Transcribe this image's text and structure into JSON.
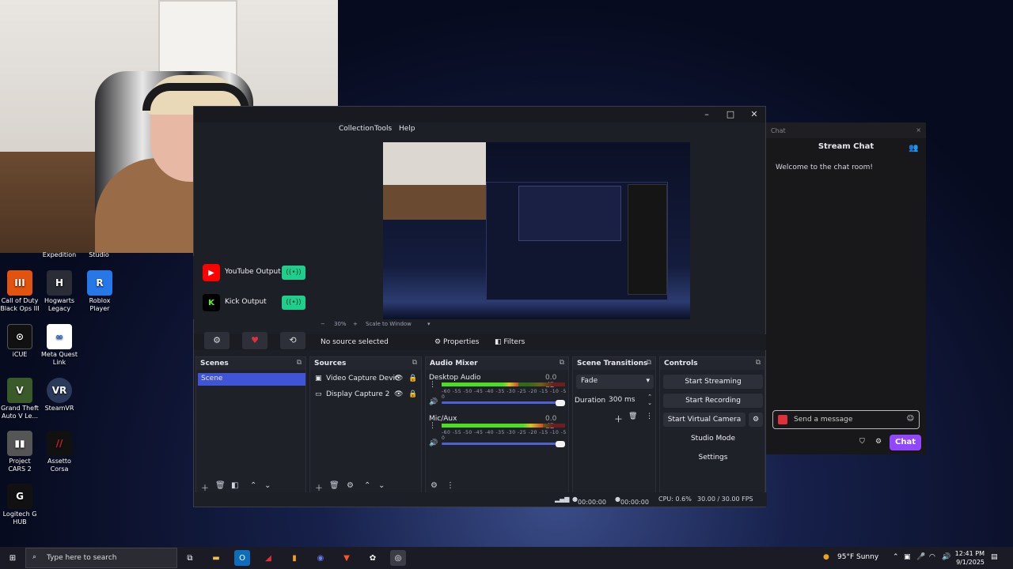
{
  "desktop": {
    "icons": [
      {
        "label": "Expedition",
        "glyph": ""
      },
      {
        "label": "Studio",
        "glyph": ""
      },
      {
        "label": "Call of Duty Black Ops III",
        "glyph": "III"
      },
      {
        "label": "Hogwarts Legacy",
        "glyph": "H"
      },
      {
        "label": "Roblox Player",
        "glyph": "R"
      },
      {
        "label": "iCUE",
        "glyph": "⊙"
      },
      {
        "label": "Meta Quest Link",
        "glyph": "∞"
      },
      {
        "label": "Grand Theft Auto V Le...",
        "glyph": "V"
      },
      {
        "label": "SteamVR",
        "glyph": "VR"
      },
      {
        "label": "Project CARS 2",
        "glyph": "▮▮"
      },
      {
        "label": "Assetto Corsa",
        "glyph": "//"
      },
      {
        "label": "Logitech G HUB",
        "glyph": "G"
      }
    ]
  },
  "obs": {
    "menu": [
      "Collection",
      "Tools",
      "Help"
    ],
    "preview_bar": {
      "zoom": "30%",
      "fit": "Scale to Window"
    },
    "source_bar": {
      "status": "No source selected",
      "properties": "Properties",
      "filters": "Filters"
    },
    "outputs": [
      {
        "label": "YouTube Output",
        "toggle": "((•))"
      },
      {
        "label": "Kick Output",
        "toggle": "((•))"
      }
    ],
    "scenes": {
      "title": "Scenes",
      "items": [
        "Scene"
      ]
    },
    "sources": {
      "title": "Sources",
      "items": [
        "Video Capture Devic",
        "Display Capture 2"
      ]
    },
    "audio": {
      "title": "Audio Mixer",
      "channels": [
        {
          "name": "Desktop Audio",
          "db": "0.0 dB",
          "level": 0.62
        },
        {
          "name": "Mic/Aux",
          "db": "0.0 dB",
          "level": 0.82
        }
      ],
      "ticks": "-60 -55 -50 -45 -40 -35 -30 -25 -20 -15 -10 -5 0"
    },
    "transitions": {
      "title": "Scene Transitions",
      "selected": "Fade",
      "duration_label": "Duration",
      "duration_value": "300 ms"
    },
    "controls": {
      "title": "Controls",
      "start_streaming": "Start Streaming",
      "start_recording": "Start Recording",
      "start_virtual_camera": "Start Virtual Camera",
      "studio_mode": "Studio Mode",
      "settings": "Settings"
    },
    "status": {
      "stream_time": "00:00:00",
      "rec_time": "00:00:00",
      "cpu": "CPU: 0.6%",
      "fps": "30.00 / 30.00 FPS"
    }
  },
  "chat": {
    "header": "Chat",
    "title": "Stream Chat",
    "welcome": "Welcome to the chat room!",
    "input_placeholder": "Send a message",
    "send_label": "Chat"
  },
  "taskbar": {
    "search_placeholder": "Type here to search",
    "weather": "95°F  Sunny",
    "time": "12:41 PM",
    "date": "9/1/2025"
  },
  "colors": {
    "accent": "#3f54d6",
    "chat_button": "#9147ff",
    "output_toggle": "#1ecf8c"
  }
}
